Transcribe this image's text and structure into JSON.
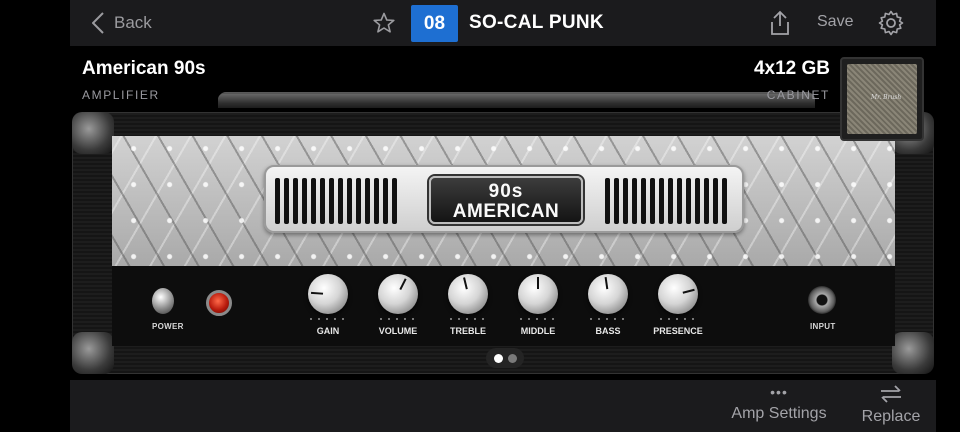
{
  "header": {
    "back_label": "Back",
    "preset_number": "08",
    "preset_name": "SO-CAL PUNK",
    "save_label": "Save"
  },
  "amplifier": {
    "name": "American 90s",
    "category_label": "AMPLIFIER",
    "badge_line1": "90s",
    "badge_line2": "AMERICAN",
    "power_label": "POWER",
    "input_label": "INPUT",
    "knobs": [
      {
        "label": "GAIN",
        "value": 0.18
      },
      {
        "label": "VOLUME",
        "value": 0.6
      },
      {
        "label": "TREBLE",
        "value": 0.45
      },
      {
        "label": "MIDDLE",
        "value": 0.5
      },
      {
        "label": "BASS",
        "value": 0.47
      },
      {
        "label": "PRESENCE",
        "value": 0.78
      }
    ]
  },
  "cabinet": {
    "name": "4x12 GB",
    "category_label": "CABINET",
    "thumb_logo": "Mr. Brush"
  },
  "pager": {
    "current": 1,
    "total": 2
  },
  "bottom_bar": {
    "amp_settings_label": "Amp Settings",
    "replace_label": "Replace"
  },
  "colors": {
    "accent": "#1e6fd2",
    "lamp": "#d2250f"
  }
}
